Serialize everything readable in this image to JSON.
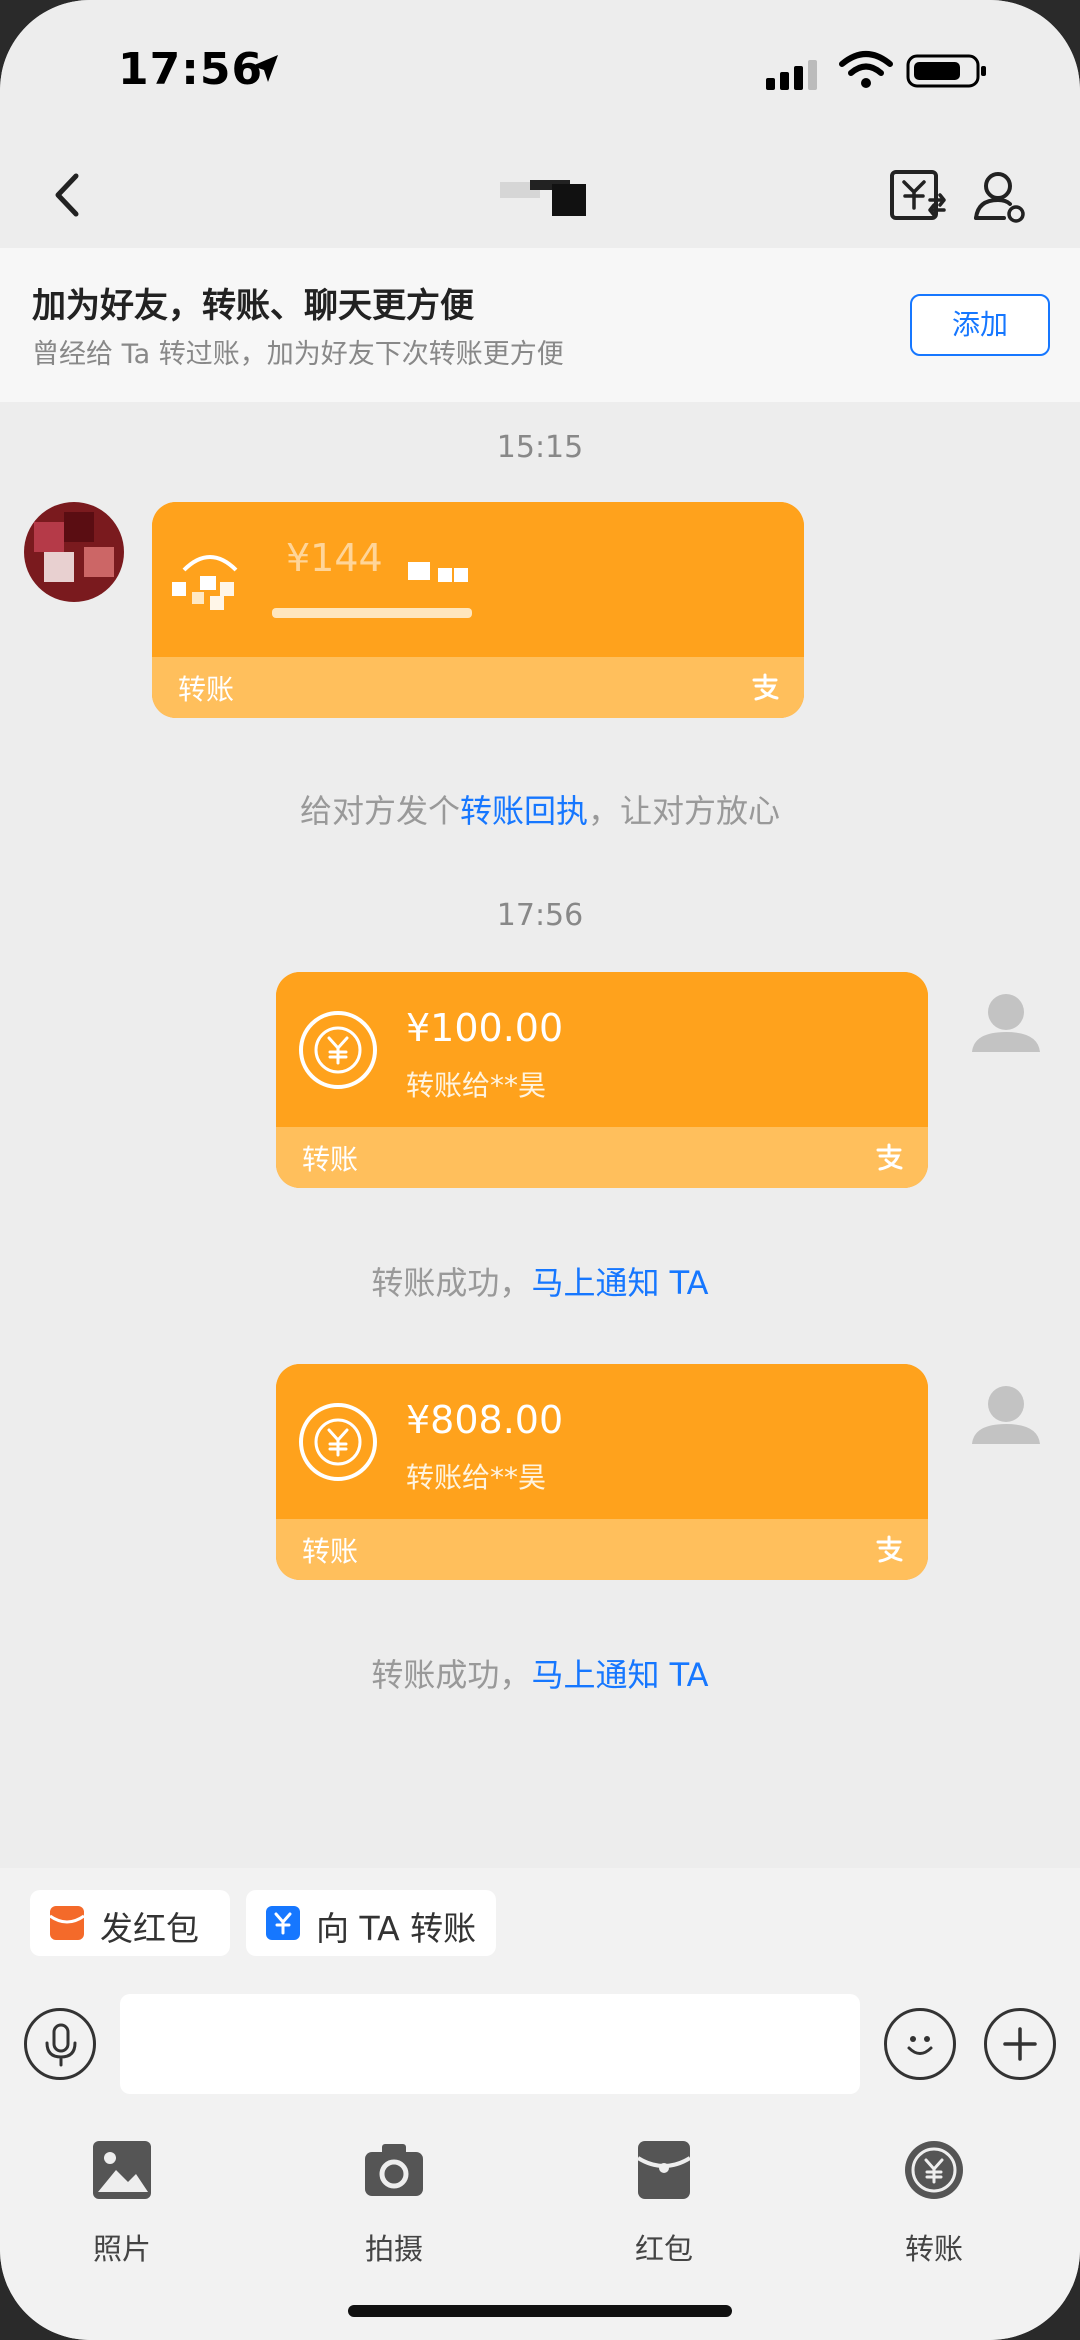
{
  "status_bar": {
    "time": "17:56"
  },
  "nav": {
    "title": ""
  },
  "friend_banner": {
    "title": "加为好友，转账、聊天更方便",
    "subtitle": "曾经给 Ta 转过账，加为好友下次转账更方便",
    "add_label": "添加"
  },
  "messages": {
    "time1": "15:15",
    "incoming": {
      "amount": "¥144",
      "label": "转账"
    },
    "receipt_hint_pre": "给对方发个",
    "receipt_hint_link": "转账回执",
    "receipt_hint_post": "，让对方放心",
    "time2": "17:56",
    "transfers": [
      {
        "amount": "¥100.00",
        "recipient": "转账给**昊",
        "label": "转账",
        "hint_pre": "转账成功，",
        "hint_link": "马上通知 TA"
      },
      {
        "amount": "¥808.00",
        "recipient": "转账给**昊",
        "label": "转账",
        "hint_pre": "转账成功，",
        "hint_link": "马上通知 TA"
      }
    ]
  },
  "quick_actions": [
    {
      "label": "发红包",
      "icon": "red-packet-icon"
    },
    {
      "label": "向 TA 转账",
      "icon": "transfer-icon"
    }
  ],
  "tools": [
    {
      "label": "照片",
      "icon": "photo-icon"
    },
    {
      "label": "拍摄",
      "icon": "camera-icon"
    },
    {
      "label": "红包",
      "icon": "red-packet-icon"
    },
    {
      "label": "转账",
      "icon": "transfer-icon"
    }
  ],
  "colors": {
    "card": "#ffa21c",
    "card_footer": "#ffbf5c",
    "link": "#1677ff",
    "background": "#ededed"
  }
}
